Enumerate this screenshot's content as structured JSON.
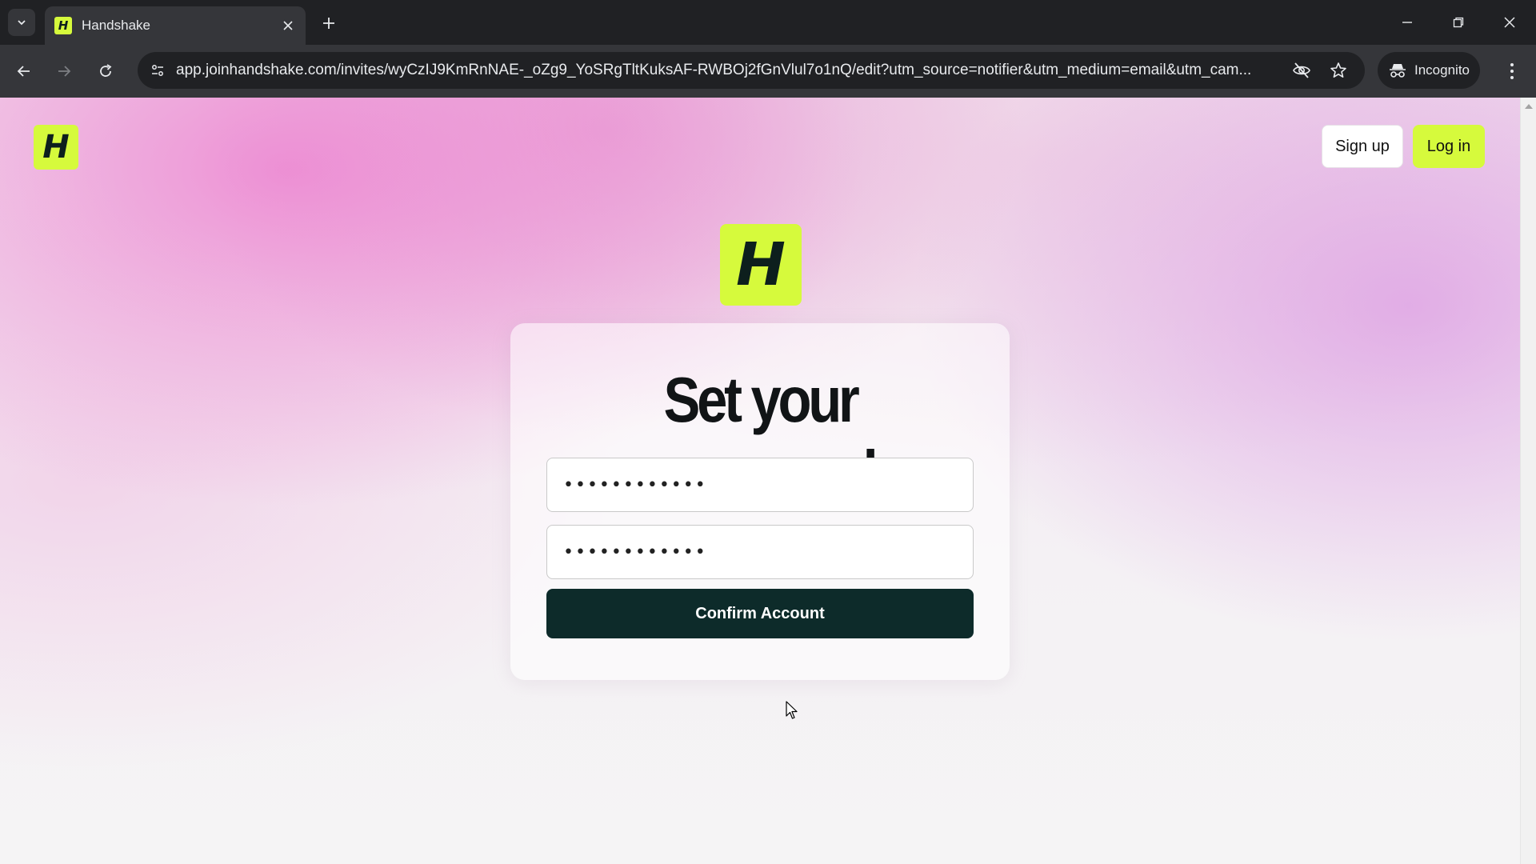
{
  "browser": {
    "tab": {
      "title": "Handshake",
      "favicon_letter": "H"
    },
    "url": "app.joinhandshake.com/invites/wyCzIJ9KmRnNAE-_oZg9_YoSRgTltKuksAF-RWBOj2fGnVlul7o1nQ/edit?utm_source=notifier&utm_medium=email&utm_cam...",
    "profile_label": "Incognito",
    "icons": [
      "tab-search-icon",
      "close-icon",
      "plus-icon",
      "minimize-icon",
      "restore-icon",
      "back-icon",
      "forward-icon",
      "reload-icon",
      "site-info-icon",
      "eye-off-icon",
      "star-icon",
      "incognito-icon",
      "kebab-menu-icon"
    ]
  },
  "header": {
    "logo_letter": "H",
    "signup_label": "Sign up",
    "login_label": "Log in"
  },
  "form": {
    "logo_letter": "H",
    "title": "Set your password",
    "password_value": "••••••••••••",
    "confirm_password_value": "••••••••••••",
    "submit_label": "Confirm Account"
  },
  "colors": {
    "brand_lime": "#d6fa3c",
    "button_dark": "#0d2b2a",
    "chrome_dark": "#202124",
    "chrome_toolbar": "#35363a"
  }
}
